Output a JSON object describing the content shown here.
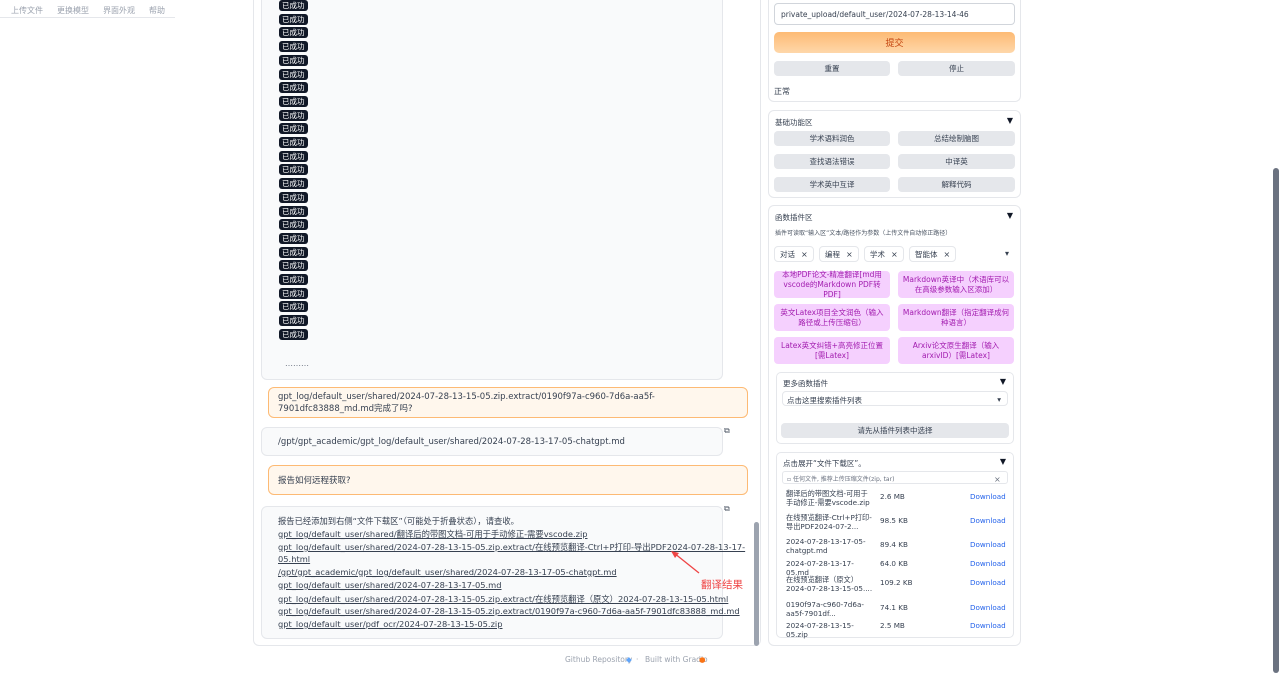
{
  "topnav": [
    "上传文件",
    "更换模型",
    "界面外观",
    "帮助"
  ],
  "chat": {
    "badge_label": "已成功",
    "badge_count": 25,
    "ellipsis": "………",
    "q1": "gpt_log/default_user/shared/2024-07-28-13-15-05.zip.extract/0190f97a-c960-7d6a-aa5f-7901dfc83888_md.md完成了吗?",
    "a1": "/gpt/gpt_academic/gpt_log/default_user/shared/2024-07-28-13-17-05-chatgpt.md",
    "q2": "报告如何远程获取?",
    "report_intro": "报告已经添加到右侧“文件下载区”（可能处于折叠状态），请查收。",
    "report_links": [
      "gpt_log/default_user/shared/翻译后的带图文档-可用于手动修正-需要vscode.zip",
      "gpt_log/default_user/shared/2024-07-28-13-15-05.zip.extract/在线预览翻译-Ctrl+P打印-导出PDF2024-07-28-13-17-",
      "05.html",
      "/gpt/gpt_academic/gpt_log/default_user/shared/2024-07-28-13-17-05-chatgpt.md",
      "gpt_log/default_user/shared/2024-07-28-13-17-05.md",
      "gpt_log/default_user/shared/2024-07-28-13-15-05.zip.extract/在线预览翻译（原文）2024-07-28-13-15-05.html",
      "gpt_log/default_user/shared/2024-07-28-13-15-05.zip.extract/0190f97a-c960-7d6a-aa5f-7901dfc83888_md.md",
      "gpt_log/default_user/pdf_ocr/2024-07-28-13-15-05.zip"
    ],
    "annotation": "翻译结果"
  },
  "footer": {
    "github": "Github Repository",
    "sep": "·",
    "gradio": "Built with Gradio"
  },
  "input_card": {
    "path_value": "private_upload/default_user/2024-07-28-13-14-46",
    "submit": "提交",
    "reset": "重置",
    "stop": "停止",
    "status": "正常"
  },
  "basic": {
    "title": "基础功能区",
    "buttons": [
      "学术语料润色",
      "总结绘制脑图",
      "查找语法错误",
      "中译英",
      "学术英中互译",
      "解释代码"
    ]
  },
  "plugins": {
    "title": "函数插件区",
    "hint": "插件可读取“输入区”文本/路径作为参数（上传文件自动修正路径）",
    "chips": [
      "对话",
      "编程",
      "学术",
      "智能体"
    ],
    "chip_dropdown": "▾",
    "buttons": [
      "本地PDF论文-精准翻译[md用vscode的Markdown PDF转PDF]",
      "Markdown英译中（术语库可以在高级参数输入区添加）",
      "英文Latex项目全文润色（输入路径或上传压缩包）",
      "Markdown翻译（指定翻译成何种语言）",
      "Latex英文纠错+高亮修正位置 [需Latex]",
      "Arxiv论文原生翻译（输入arxivID）[需Latex]"
    ]
  },
  "more": {
    "title": "更多函数插件",
    "select": "点击这里搜索插件列表",
    "select_first": "请先从插件列表中选择"
  },
  "download": {
    "title": "点击展开“文件下载区”。",
    "upload_hint": "任何文件, 推荐上传压缩文件(zip, tar)",
    "close": "×",
    "link_label": "Download",
    "files": [
      {
        "name": "翻译后的带图文档-可用于手动修正-需要vscode.zip",
        "size": "2.6 MB"
      },
      {
        "name": "在线预览翻译-Ctrl+P打印-导出PDF2024-07-2...",
        "size": "98.5 KB"
      },
      {
        "name": "2024-07-28-13-17-05-chatgpt.md",
        "size": "89.4 KB"
      },
      {
        "name": "2024-07-28-13-17-05.md",
        "size": "64.0 KB"
      },
      {
        "name": "在线预览翻译（原文）2024-07-28-13-15-05....",
        "size": "109.2 KB"
      },
      {
        "name": "0190f97a-c960-7d6a-aa5f-7901df...",
        "size": "74.1 KB"
      },
      {
        "name": "2024-07-28-13-15-05.zip",
        "size": "2.5 MB"
      }
    ]
  }
}
